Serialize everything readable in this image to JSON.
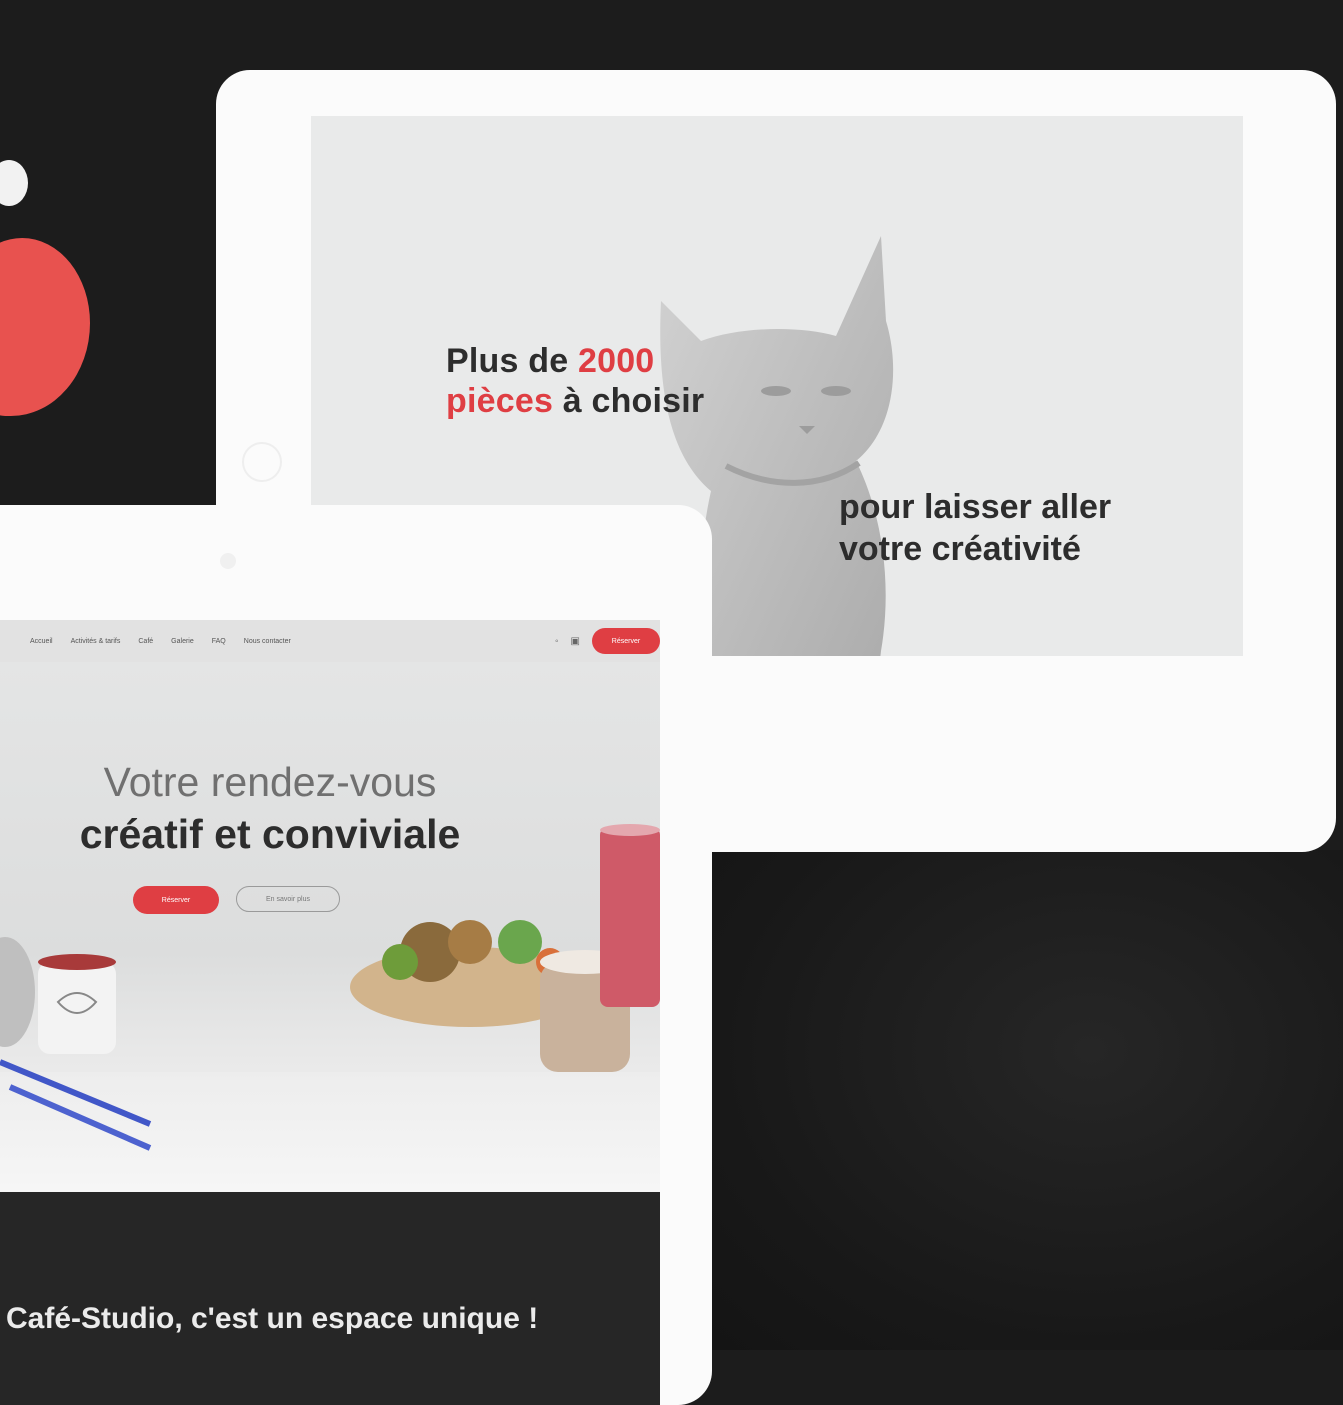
{
  "back_tablet": {
    "headline_part1": "Plus de ",
    "headline_accent": "2000",
    "headline_accent2": "pièces",
    "headline_part2": " à choisir",
    "subheadline_line1": "pour laisser aller",
    "subheadline_line2": "votre créativité"
  },
  "front_tablet": {
    "nav": {
      "items": [
        "Accueil",
        "Activités & tarifs",
        "Café",
        "Galerie",
        "FAQ",
        "Nous contacter"
      ],
      "cta_label": "Réserver"
    },
    "hero": {
      "title_light": "Votre rendez-vous",
      "title_bold": "créatif et conviviale",
      "primary_button": "Réserver",
      "secondary_button": "En savoir plus"
    },
    "band_text": "Café-Studio, c'est un espace unique !"
  },
  "colors": {
    "accent": "#df3e43",
    "background": "#1c1c1c",
    "blob": "#e8524f"
  }
}
